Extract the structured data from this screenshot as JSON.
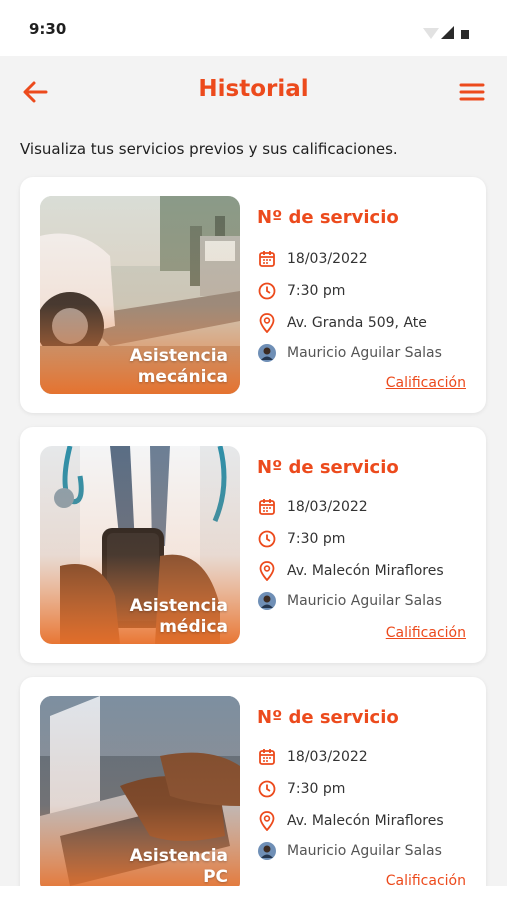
{
  "status_bar": {
    "time": "9:30"
  },
  "header": {
    "title": "Historial"
  },
  "subtitle": "Visualiza tus servicios previos y sus calificaciones.",
  "colors": {
    "accent": "#ec4a1c",
    "background": "#f3f3f3",
    "card": "#ffffff"
  },
  "icons": {
    "back": "arrow-left-icon",
    "menu": "hamburger-menu-icon",
    "date": "calendar-icon",
    "time": "clock-icon",
    "location": "location-pin-icon",
    "user": "user-avatar-icon"
  },
  "services": [
    {
      "label_line1": "Asistencia",
      "label_line2": "mecánica",
      "title": "Nº de servicio",
      "date": "18/03/2022",
      "time": "7:30 pm",
      "address": "Av. Granda 509, Ate",
      "person": "Mauricio Aguilar Salas",
      "link": "Calificación"
    },
    {
      "label_line1": "Asistencia",
      "label_line2": "médica",
      "title": "Nº de servicio",
      "date": "18/03/2022",
      "time": "7:30 pm",
      "address": "Av. Malecón Miraflores",
      "person": "Mauricio Aguilar Salas",
      "link": "Calificación"
    },
    {
      "label_line1": "Asistencia",
      "label_line2": "PC",
      "title": "Nº de servicio",
      "date": "18/03/2022",
      "time": "7:30 pm",
      "address": "Av. Malecón Miraflores",
      "person": "Mauricio Aguilar Salas",
      "link": "Calificación"
    }
  ]
}
